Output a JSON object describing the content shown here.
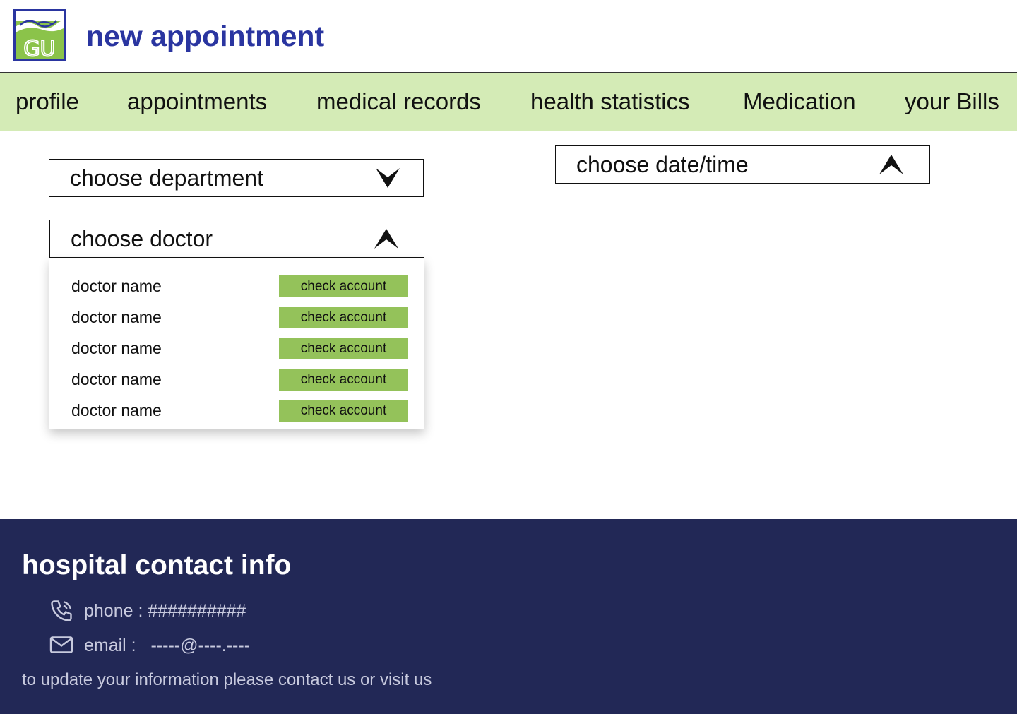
{
  "header": {
    "logo_text": "GU",
    "title": "new appointment"
  },
  "nav": {
    "items": [
      {
        "label": "profile"
      },
      {
        "label": "appointments"
      },
      {
        "label": "medical records"
      },
      {
        "label": "health statistics"
      },
      {
        "label": "Medication"
      },
      {
        "label": "your Bills"
      }
    ]
  },
  "form": {
    "department": {
      "label": "choose department",
      "icon": "chevron-down-icon",
      "expanded": false
    },
    "doctor": {
      "label": "choose doctor",
      "icon": "chevron-up-icon",
      "expanded": true
    },
    "datetime": {
      "label": "choose date/time",
      "icon": "chevron-up-icon",
      "expanded": true
    }
  },
  "doctors": [
    {
      "name": "doctor name",
      "button": "check account"
    },
    {
      "name": "doctor name",
      "button": "check account"
    },
    {
      "name": "doctor name",
      "button": "check account"
    },
    {
      "name": "doctor name",
      "button": "check account"
    },
    {
      "name": "doctor name",
      "button": "check account"
    }
  ],
  "footer": {
    "title": "hospital contact info",
    "phone": {
      "icon": "phone-icon",
      "text": "phone : ##########"
    },
    "email": {
      "icon": "mail-icon",
      "text": "email :   -----@----.----"
    },
    "note": "to update your information please contact us or visit us"
  },
  "colors": {
    "brand_blue": "#2a35a0",
    "nav_bg": "#d4ebb6",
    "button_green": "#94c25a",
    "footer_bg": "#222856",
    "logo_green": "#8bc34a"
  }
}
